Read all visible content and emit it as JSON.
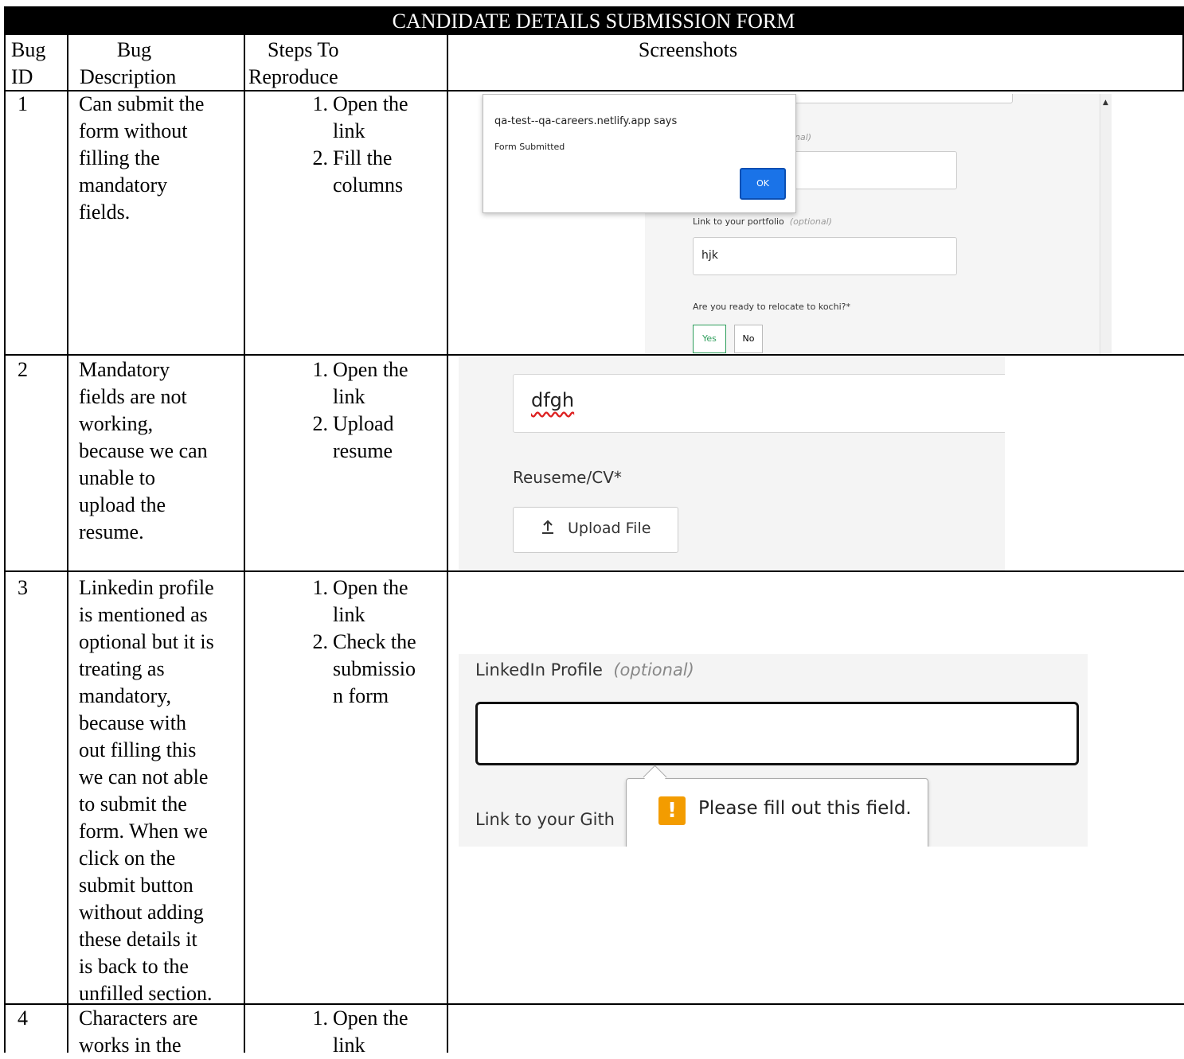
{
  "form_title": "CANDIDATE DETAILS SUBMISSION FORM",
  "headers": {
    "bug_id": [
      "Bug",
      "ID"
    ],
    "bug_description": [
      "Bug",
      "Description"
    ],
    "steps": [
      "Steps To",
      "Reproduce"
    ],
    "screenshots": "Screenshots"
  },
  "rows": [
    {
      "id": "1",
      "description": [
        "Can submit the",
        "form without",
        "filling the",
        "mandatory",
        "fields."
      ],
      "steps": [
        {
          "num": "1.",
          "lines": [
            "Open the",
            "link"
          ]
        },
        {
          "num": "2.",
          "lines": [
            "Fill the",
            "columns"
          ]
        }
      ]
    },
    {
      "id": "2",
      "description": [
        "Mandatory",
        "fields are not",
        "working,",
        "because we can",
        "unable to",
        "upload the",
        "resume."
      ],
      "steps": [
        {
          "num": "1.",
          "lines": [
            "Open the",
            "link"
          ]
        },
        {
          "num": "2.",
          "lines": [
            "Upload",
            "resume"
          ]
        }
      ]
    },
    {
      "id": "3",
      "description": [
        "Linkedin profile",
        "is mentioned as",
        "optional but it is",
        "treating as",
        "mandatory,",
        "because with",
        "out filling this",
        "we can not able",
        "to submit the",
        "form. When we",
        "click on the",
        "submit button",
        "without adding",
        "these details it",
        "is back to the",
        "unfilled section."
      ],
      "steps": [
        {
          "num": "1.",
          "lines": [
            "Open the",
            "link"
          ]
        },
        {
          "num": "2.",
          "lines": [
            "Check the",
            "submissio",
            "n form"
          ]
        }
      ]
    },
    {
      "id": "4",
      "description": [
        "Characters are",
        "works in the"
      ],
      "steps": [
        {
          "num": "1.",
          "lines": [
            "Open the",
            "link"
          ]
        }
      ]
    }
  ],
  "screenshot1": {
    "dialog_title": "qa-test--qa-careers.netlify.app says",
    "dialog_message": "Form Submitted",
    "ok_label": "OK",
    "partial_label": "nal)",
    "portfolio_label": "Link to your portfolio",
    "optional_text": "(optional)",
    "portfolio_value": "hjk",
    "relocate_label": "Are you ready to relocate to kochi?*",
    "yes_label": "Yes",
    "no_label": "No"
  },
  "screenshot2": {
    "input_value": "dfgh",
    "resume_label": "Reuseme/CV*",
    "upload_label": "Upload File",
    "upload_icon": "upload-icon"
  },
  "screenshot3": {
    "linkedin_label": "LinkedIn Profile",
    "optional_text": "(optional)",
    "github_label": "Link to your Gith",
    "tooltip_text": "Please fill out this field.",
    "warning_icon": "!",
    "warning_color": "#f39c00"
  }
}
